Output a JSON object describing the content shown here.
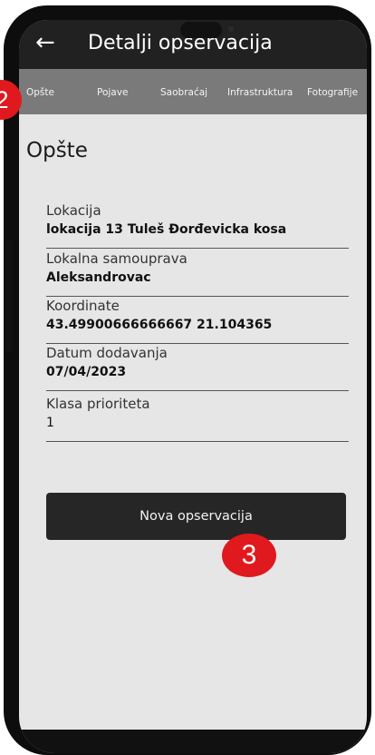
{
  "appbar": {
    "title": "Detalji opservacija",
    "back_icon": "arrow-left-icon"
  },
  "tabs": [
    {
      "label": "Opšte",
      "active": true
    },
    {
      "label": "Pojave"
    },
    {
      "label": "Saobraćaj"
    },
    {
      "label": "Infrastruktura"
    },
    {
      "label": "Fotografije"
    }
  ],
  "section": {
    "title": "Opšte"
  },
  "fields": [
    {
      "label": "Lokacija",
      "value": "lokacija 13 Tuleš Đorđevicka kosa"
    },
    {
      "label": "Lokalna samouprava",
      "value": "Aleksandrovac"
    },
    {
      "label": "Koordinate",
      "value": "43.49900666666667 21.104365"
    },
    {
      "label": "Datum dodavanja",
      "value": "07/04/2023"
    },
    {
      "label": "Klasa prioriteta",
      "value": "1"
    }
  ],
  "button": {
    "label": "Nova opservacija"
  },
  "annotations": {
    "badge_2": "2",
    "badge_3": "3",
    "color": "#e0191e"
  },
  "colors": {
    "appbar": "#212121",
    "tabbar": "#7a7a7a",
    "screen_bg": "#e6e6e6",
    "button_bg": "#262626"
  }
}
